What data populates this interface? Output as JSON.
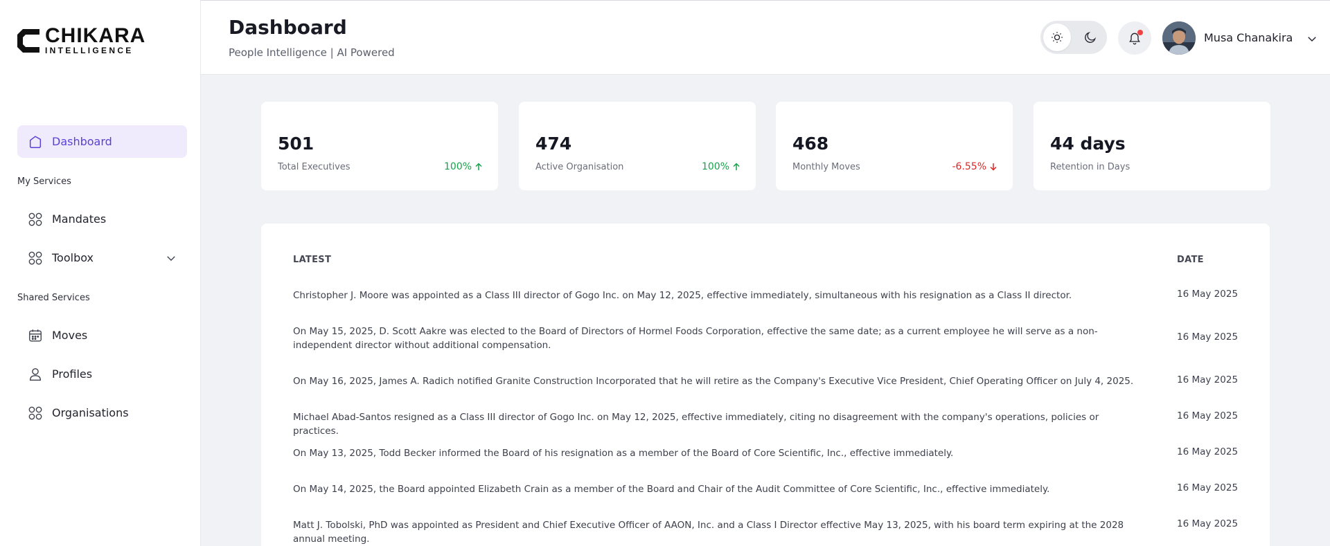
{
  "brand": {
    "name": "CHIKARA",
    "tagline": "INTELLIGENCE"
  },
  "sidebar": {
    "dashboard": "Dashboard",
    "section_my": "My Services",
    "mandates": "Mandates",
    "toolbox": "Toolbox",
    "section_shared": "Shared Services",
    "moves": "Moves",
    "profiles": "Profiles",
    "organisations": "Organisations"
  },
  "header": {
    "title": "Dashboard",
    "subtitle": "People Intelligence | AI Powered",
    "user_name": "Musa Chanakira"
  },
  "stats": [
    {
      "value": "501",
      "label": "Total Executives",
      "delta": "100%",
      "trend": "up"
    },
    {
      "value": "474",
      "label": "Active Organisation",
      "delta": "100%",
      "trend": "up"
    },
    {
      "value": "468",
      "label": "Monthly Moves",
      "delta": "-6.55%",
      "trend": "down"
    },
    {
      "value": "44 days",
      "label": "Retention in Days",
      "delta": "",
      "trend": ""
    }
  ],
  "latest": {
    "col_latest": "LATEST",
    "col_date": "DATE",
    "rows": [
      {
        "text": "Christopher J. Moore was appointed as a Class III director of Gogo Inc. on May 12, 2025, effective immediately, simultaneous with his resignation as a Class II director.",
        "date": "16 May 2025"
      },
      {
        "text": "On May 15, 2025, D. Scott Aakre was elected to the Board of Directors of Hormel Foods Corporation, effective the same date; as a current employee he will serve as a non-independent director without additional compensation.",
        "date": "16 May 2025"
      },
      {
        "text": "On May 16, 2025, James A. Radich notified Granite Construction Incorporated that he will retire as the Company's Executive Vice President, Chief Operating Officer on July 4, 2025.",
        "date": "16 May 2025"
      },
      {
        "text": "Michael Abad-Santos resigned as a Class III director of Gogo Inc. on May 12, 2025, effective immediately, citing no disagreement with the company's operations, policies or practices.",
        "date": "16 May 2025"
      },
      {
        "text": "On May 13, 2025, Todd Becker informed the Board of his resignation as a member of the Board of Core Scientific, Inc., effective immediately.",
        "date": "16 May 2025"
      },
      {
        "text": "On May 14, 2025, the Board appointed Elizabeth Crain as a member of the Board and Chair of the Audit Committee of Core Scientific, Inc., effective immediately.",
        "date": "16 May 2025"
      },
      {
        "text": "Matt J. Tobolski, PhD was appointed as President and Chief Executive Officer of AAON, Inc. and a Class I Director effective May 13, 2025, with his board term expiring at the 2028 annual meeting.",
        "date": "16 May 2025"
      }
    ]
  },
  "colors": {
    "accent": "#5a3fd8",
    "accent_bg": "#efebfc",
    "up": "#15a34a",
    "down": "#dc2626",
    "notify": "#ef4444"
  },
  "icons": [
    "logo-mark-icon",
    "home-icon",
    "grid-icon",
    "chevron-down-icon",
    "calendar-icon",
    "user-icon",
    "sun-icon",
    "moon-icon",
    "bell-icon",
    "arrow-up-icon",
    "arrow-down-icon"
  ]
}
